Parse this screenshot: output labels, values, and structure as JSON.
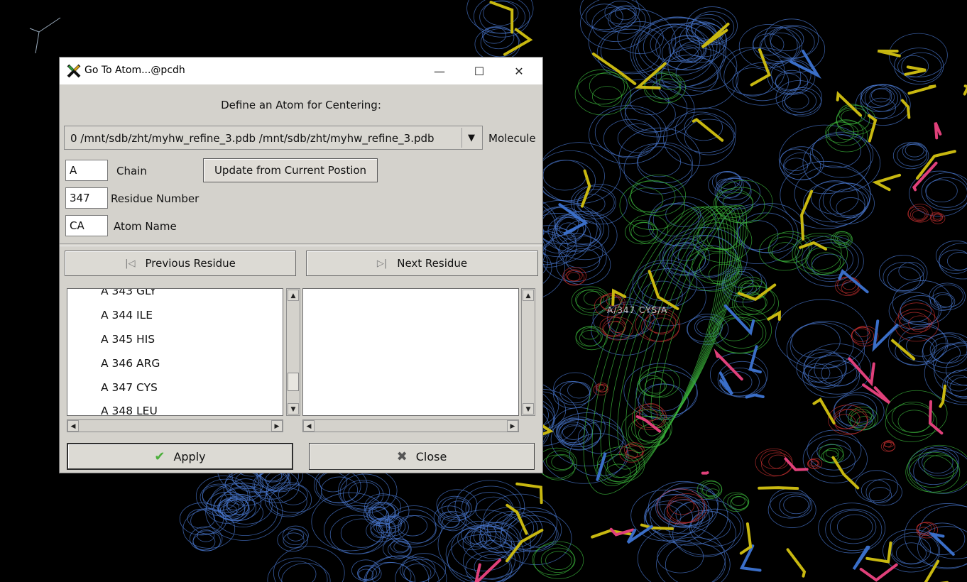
{
  "window": {
    "title": "Go To Atom...@pcdh",
    "minimize_glyph": "—",
    "maximize_glyph": "☐",
    "close_glyph": "✕"
  },
  "viewer": {
    "atom_label": "A/347 CYS/A"
  },
  "dialog": {
    "header": "Define an Atom for Centering:",
    "molecule_select_value": "0  /mnt/sdb/zht/myhw_refine_3.pdb  /mnt/sdb/zht/myhw_refine_3.pdb",
    "molecule_label": "Molecule",
    "chain_value": "A",
    "chain_label": "Chain",
    "residue_value": "347",
    "residue_label": "Residue Number",
    "atom_value": "CA",
    "atom_label": "Atom Name",
    "update_button": "Update from Current Postion",
    "prev_button": "Previous Residue",
    "next_button": "Next Residue",
    "residues": [
      "A 343 GLY",
      "A 344 ILE",
      "A 345 HIS",
      "A 346 ARG",
      "A 347 CYS",
      "A 348 LEU"
    ],
    "apply_button": "Apply",
    "close_button": "Close"
  },
  "colors": {
    "map_blue": "#4a78d0",
    "map_green": "#3cb83c",
    "map_red": "#c83030",
    "bond_yellow": "#c8b810",
    "dialog_bg": "#d4d2cc"
  },
  "icons": {
    "app": "x-logo-icon",
    "prev": "skip-previous-icon",
    "next": "skip-next-icon",
    "apply": "checkmark-icon",
    "close": "close-x-icon"
  }
}
